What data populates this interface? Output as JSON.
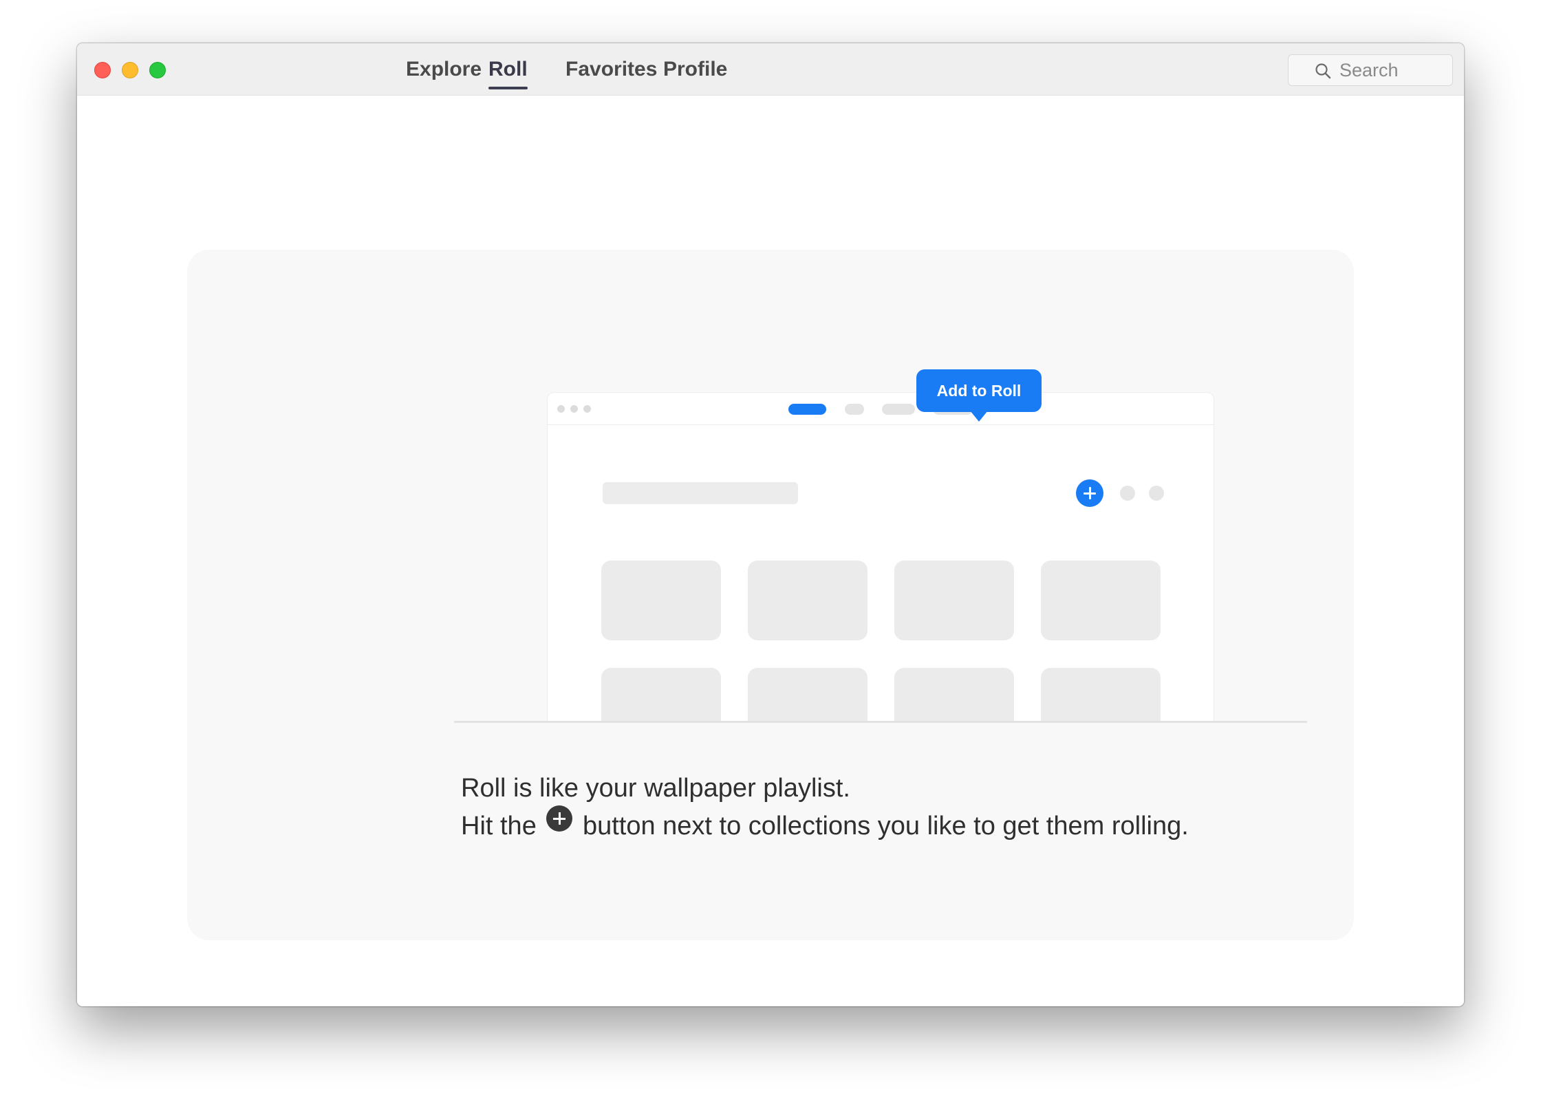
{
  "window": {
    "controls": [
      "close",
      "minimize",
      "zoom"
    ]
  },
  "nav": {
    "tabs": [
      {
        "label": "Explore"
      },
      {
        "label": "Roll",
        "active": true
      },
      {
        "label": "Favorites"
      },
      {
        "label": "Profile"
      }
    ]
  },
  "search": {
    "placeholder": "Search",
    "icon": "search-icon"
  },
  "illustration": {
    "tooltip": "Add to Roll",
    "add_icon": "plus-circle-icon"
  },
  "message": {
    "line1": "Roll is like your wallpaper playlist.",
    "line2_before": "Hit the",
    "line2_after": "button next to collections you like to get them rolling.",
    "inline_icon": "plus-circle-icon"
  },
  "colors": {
    "accent": "#1a7cf5",
    "close": "#fe5f57",
    "minimize": "#febc2e",
    "zoom": "#28c840"
  }
}
